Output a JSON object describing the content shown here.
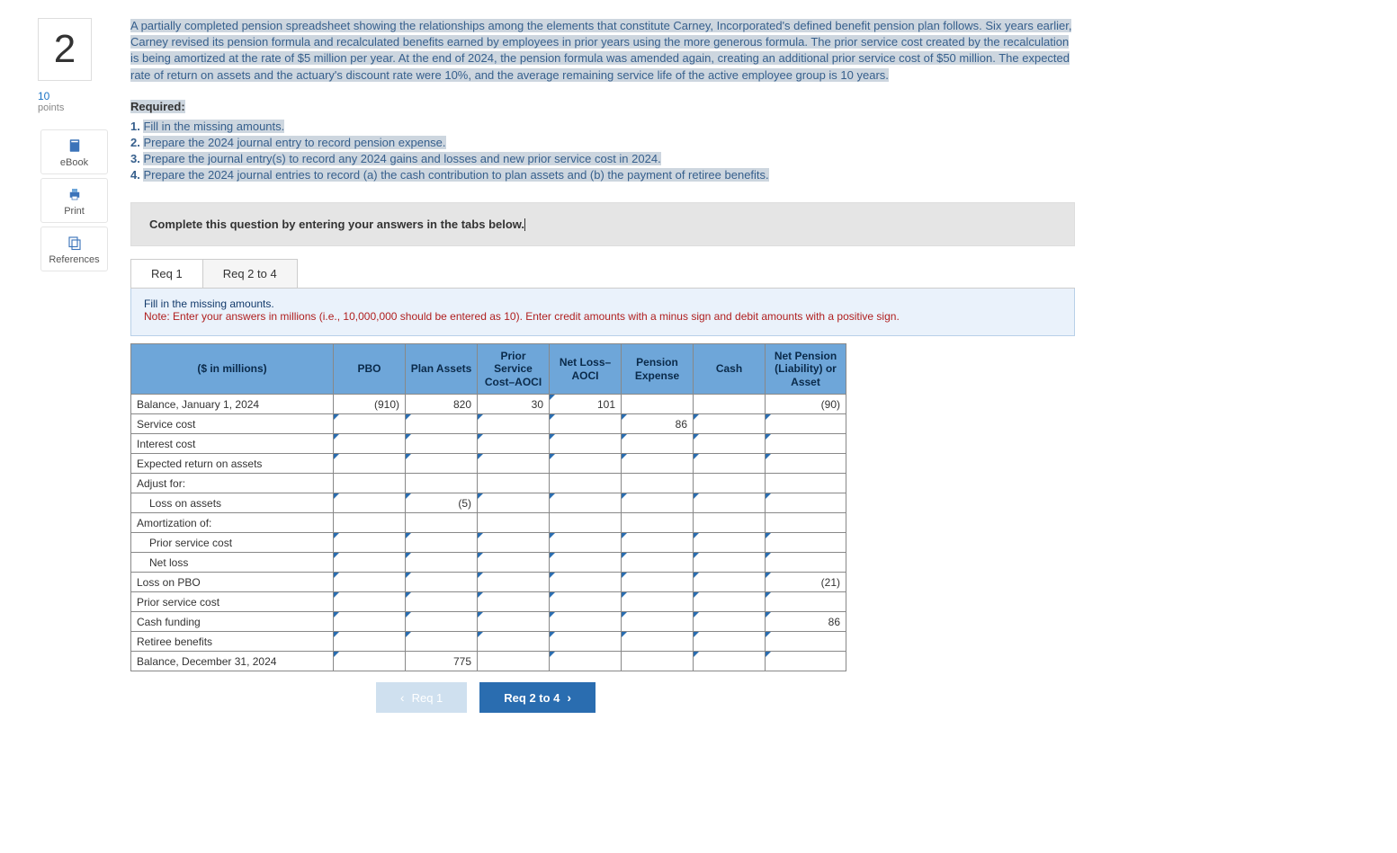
{
  "sidebar": {
    "question_number": "2",
    "points_value": "10",
    "points_label": "points",
    "ebook_label": "eBook",
    "print_label": "Print",
    "references_label": "References"
  },
  "problem": {
    "text": "A partially completed pension spreadsheet showing the relationships among the elements that constitute Carney, Incorporated's defined benefit pension plan follows. Six years earlier, Carney revised its pension formula and recalculated benefits earned by employees in prior years using the more generous formula. The prior service cost created by the recalculation is being amortized at the rate of $5 million per year. At the end of 2024, the pension formula was amended again, creating an additional prior service cost of $50 million. The expected rate of return on assets and the actuary's discount rate were 10%, and the average remaining service life of the active employee group is 10 years.",
    "required_label": "Required:",
    "requirements": [
      "Fill in the missing amounts.",
      "Prepare the 2024 journal entry to record pension expense.",
      "Prepare the journal entry(s) to record any 2024 gains and losses and new prior service cost in 2024.",
      "Prepare the 2024 journal entries to record (a) the cash contribution to plan assets and (b) the payment of retiree benefits."
    ],
    "instruction_bar": "Complete this question by entering your answers in the tabs below."
  },
  "tabs": {
    "req1": "Req 1",
    "req2to4": "Req 2 to 4"
  },
  "note": {
    "heading": "Fill in the missing amounts.",
    "note_prefix": "Note: ",
    "note_body": "Enter your answers in millions (i.e., 10,000,000 should be entered as 10). Enter credit amounts with a minus sign and debit amounts with a positive sign."
  },
  "table": {
    "headers": {
      "label": "($ in millions)",
      "pbo": "PBO",
      "plan_assets": "Plan Assets",
      "psc_aoci": "Prior Service Cost–AOCI",
      "net_loss_aoci": "Net Loss–AOCI",
      "pension_expense": "Pension Expense",
      "cash": "Cash",
      "net_pension": "Net Pension (Liability) or Asset"
    },
    "rows": {
      "r0": {
        "label": "Balance, January 1, 2024",
        "pbo": "(910)",
        "plan_assets": "820",
        "psc_aoci": "30",
        "net_loss_aoci": "101",
        "pension_expense": "",
        "cash": "",
        "net_pension": "(90)"
      },
      "r1": {
        "label": "Service cost",
        "pbo": "",
        "plan_assets": "",
        "psc_aoci": "",
        "net_loss_aoci": "",
        "pension_expense": "86",
        "cash": "",
        "net_pension": ""
      },
      "r2": {
        "label": "Interest cost",
        "pbo": "",
        "plan_assets": "",
        "psc_aoci": "",
        "net_loss_aoci": "",
        "pension_expense": "",
        "cash": "",
        "net_pension": ""
      },
      "r3": {
        "label": "Expected return on assets",
        "pbo": "",
        "plan_assets": "",
        "psc_aoci": "",
        "net_loss_aoci": "",
        "pension_expense": "",
        "cash": "",
        "net_pension": ""
      },
      "r4": {
        "label": "Adjust for:"
      },
      "r5": {
        "label": "Loss on assets",
        "pbo": "",
        "plan_assets": "(5)",
        "psc_aoci": "",
        "net_loss_aoci": "",
        "pension_expense": "",
        "cash": "",
        "net_pension": ""
      },
      "r6": {
        "label": "Amortization of:"
      },
      "r7": {
        "label": "Prior service cost",
        "pbo": "",
        "plan_assets": "",
        "psc_aoci": "",
        "net_loss_aoci": "",
        "pension_expense": "",
        "cash": "",
        "net_pension": ""
      },
      "r8": {
        "label": "Net loss",
        "pbo": "",
        "plan_assets": "",
        "psc_aoci": "",
        "net_loss_aoci": "",
        "pension_expense": "",
        "cash": "",
        "net_pension": ""
      },
      "r9": {
        "label": "Loss on PBO",
        "pbo": "",
        "plan_assets": "",
        "psc_aoci": "",
        "net_loss_aoci": "",
        "pension_expense": "",
        "cash": "",
        "net_pension": "(21)"
      },
      "r10": {
        "label": "Prior service cost",
        "pbo": "",
        "plan_assets": "",
        "psc_aoci": "",
        "net_loss_aoci": "",
        "pension_expense": "",
        "cash": "",
        "net_pension": ""
      },
      "r11": {
        "label": "Cash funding",
        "pbo": "",
        "plan_assets": "",
        "psc_aoci": "",
        "net_loss_aoci": "",
        "pension_expense": "",
        "cash": "",
        "net_pension": "86"
      },
      "r12": {
        "label": "Retiree benefits",
        "pbo": "",
        "plan_assets": "",
        "psc_aoci": "",
        "net_loss_aoci": "",
        "pension_expense": "",
        "cash": "",
        "net_pension": ""
      },
      "r13": {
        "label": "Balance, December 31, 2024",
        "pbo": "",
        "plan_assets": "775",
        "psc_aoci": "",
        "net_loss_aoci": "",
        "pension_expense": "",
        "cash": "",
        "net_pension": ""
      }
    }
  },
  "nav": {
    "prev": "Req 1",
    "next": "Req 2 to 4"
  }
}
